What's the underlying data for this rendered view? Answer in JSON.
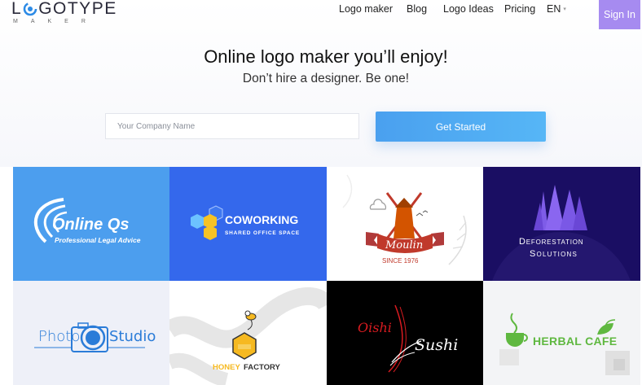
{
  "brand": {
    "name_start": "L",
    "name_end": "GOTYPE",
    "tagline": "MAKER"
  },
  "nav": {
    "items": [
      "Logo maker",
      "Blog",
      "Logo Ideas",
      "Pricing"
    ],
    "lang": "EN",
    "signin": "Sign In"
  },
  "hero": {
    "title": "Online logo maker you’ll enjoy!",
    "subtitle": "Don’t hire a designer. Be one!",
    "input_placeholder": "Your Company Name",
    "cta": "Get Started"
  },
  "tiles": {
    "online_qs": {
      "title": "Online Qs",
      "subtitle": "Professional Legal Advice"
    },
    "coworking": {
      "title": "COWORKING",
      "subtitle": "SHARED OFFICE SPACE"
    },
    "moulin": {
      "title": "Moulin",
      "subtitle": "SINCE 1976"
    },
    "deforestation": {
      "title": "Deforestation",
      "subtitle": "Solutions"
    },
    "photo_studio": {
      "left": "Photo",
      "right": "Studio"
    },
    "honey": {
      "part1": "HONEY",
      "part2": "FACTORY"
    },
    "sushi": {
      "part1": "Oishi",
      "part2": "Sushi"
    },
    "herbal": {
      "title": "HERBAL CAFE"
    }
  },
  "colors": {
    "accent_purple": "#a68bf0",
    "cta_blue": "#4aa0ef",
    "tile_blue": "#4c9eee",
    "tile_royal": "#3468ec",
    "tile_navy": "#1a0e63",
    "herbal_green": "#5fb840",
    "honey_yellow": "#f6b920"
  },
  "icons": [
    "swirl-logo-icon",
    "chevron-down-icon",
    "wave-icon",
    "cube-icon",
    "windmill-icon",
    "pine-tree-icon",
    "camera-icon",
    "honey-pot-icon",
    "bee-icon",
    "chopsticks-icon",
    "tea-cup-icon",
    "leaf-icon"
  ]
}
